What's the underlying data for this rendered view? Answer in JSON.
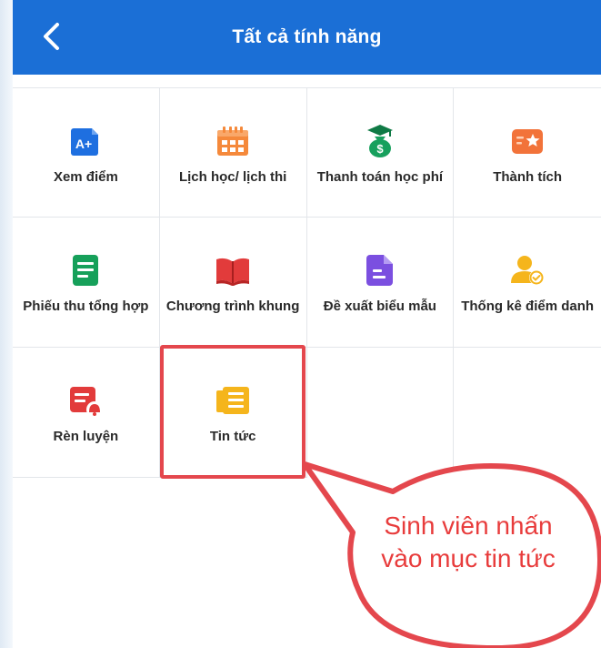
{
  "header": {
    "title": "Tất cả tính năng",
    "background_color": "#1b6fd6"
  },
  "features": [
    {
      "label": "Xem điểm",
      "icon": "grade-a-plus-icon",
      "color": "#1e6fe0"
    },
    {
      "label": "Lịch học/ lịch thi",
      "icon": "calendar-icon",
      "color": "#f5893b"
    },
    {
      "label": "Thanh toán học phí",
      "icon": "money-bag-graduation-icon",
      "color": "#17a05d"
    },
    {
      "label": "Thành tích",
      "icon": "achievement-star-icon",
      "color": "#f2733a"
    },
    {
      "label": "Phiếu thu tổng hợp",
      "icon": "receipt-document-icon",
      "color": "#16a05a"
    },
    {
      "label": "Chương trình khung",
      "icon": "open-book-icon",
      "color": "#e23b3b"
    },
    {
      "label": "Đề xuất biểu mẫu",
      "icon": "form-document-icon",
      "color": "#7b4fe0"
    },
    {
      "label": "Thống kê điểm danh",
      "icon": "user-check-icon",
      "color": "#f5b51c"
    },
    {
      "label": "Rèn luyện",
      "icon": "training-bell-icon",
      "color": "#e23b3b"
    },
    {
      "label": "Tin tức",
      "icon": "news-icon",
      "color": "#f5b51c"
    }
  ],
  "annotation": {
    "callout_text": "Sinh viên nhấn vào mục tin tức",
    "highlight_color": "#e4474d",
    "text_color": "#e83c3c"
  }
}
